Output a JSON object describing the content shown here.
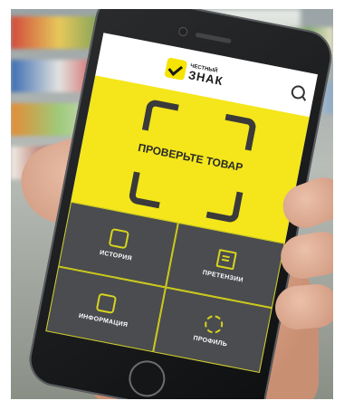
{
  "app": {
    "logo_small": "ЧЕСТНЫЙ",
    "logo_big": "ЗНАК",
    "scan_label": "ПРОВЕРЬТЕ ТОВАР",
    "menu": [
      {
        "label": "ИСТОРИЯ",
        "icon": "scan-frame-icon"
      },
      {
        "label": "ПРЕТЕНЗИИ",
        "icon": "document-icon"
      },
      {
        "label": "ИНФОРМАЦИЯ",
        "icon": "scan-frame-icon"
      },
      {
        "label": "ПРОФИЛЬ",
        "icon": "gear-icon"
      }
    ]
  },
  "colors": {
    "brand_yellow": "#f4e61a",
    "menu_bg": "#4a4c4f",
    "accent_line": "#d3d11a"
  }
}
